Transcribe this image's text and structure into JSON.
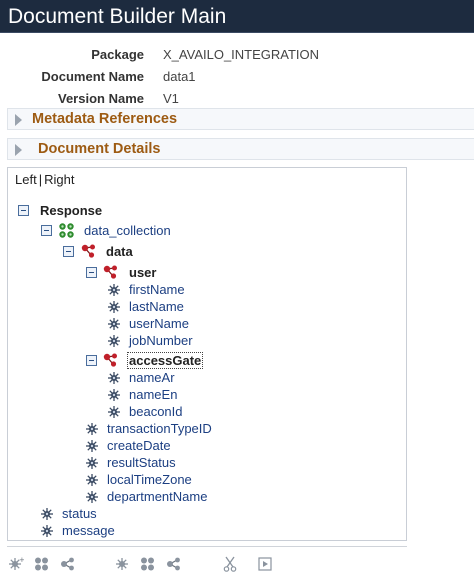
{
  "header": {
    "title": "Document Builder Main"
  },
  "fields": [
    {
      "label": "Package",
      "value": "X_AVAILO_INTEGRATION"
    },
    {
      "label": "Document Name",
      "value": "data1"
    },
    {
      "label": "Version Name",
      "value": "V1"
    }
  ],
  "sections": {
    "metadata_references": "Metadata References",
    "document_details": "Document Details"
  },
  "view_toggle": {
    "left": "Left",
    "separator": "|",
    "right": "Right"
  },
  "tree": {
    "root": "Response",
    "data_collection": "data_collection",
    "data": "data",
    "user": "user",
    "user_fields": [
      "firstName",
      "lastName",
      "userName",
      "jobNumber"
    ],
    "access_gate": "accessGate",
    "access_gate_fields": [
      "nameAr",
      "nameEn",
      "beaconId"
    ],
    "data_fields": [
      "transactionTypeID",
      "createDate",
      "resultStatus",
      "localTimeZone",
      "departmentName"
    ],
    "root_fields": [
      "status",
      "message"
    ]
  },
  "toolbar": {
    "icons": [
      "add-element-icon",
      "add-collection-icon",
      "add-compound-icon",
      "insert-element-icon",
      "insert-collection-icon",
      "insert-compound-icon",
      "cut-icon",
      "paste-icon"
    ]
  },
  "colors": {
    "titlebar": "#1d2b3f",
    "section_title": "#9d5b13",
    "link": "#1c3f82",
    "collection_icon": "#2e8b2e",
    "compound_icon": "#c0202a",
    "element_icon": "#3b4b63"
  }
}
